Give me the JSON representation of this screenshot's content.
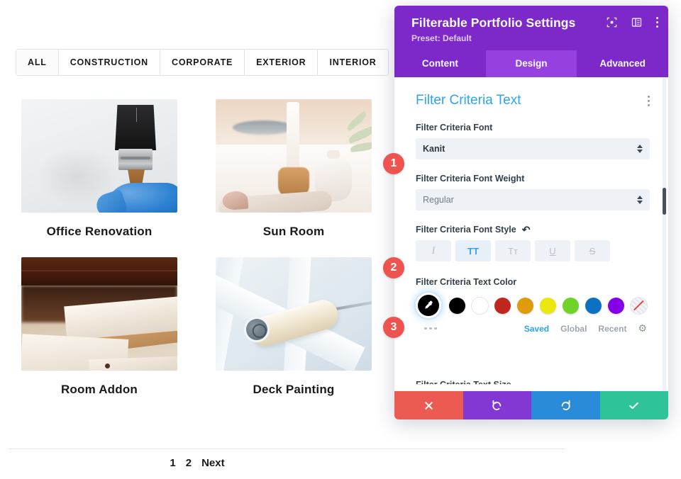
{
  "portfolio": {
    "filters": [
      {
        "label": "ALL",
        "active": true
      },
      {
        "label": "CONSTRUCTION",
        "active": false
      },
      {
        "label": "CORPORATE",
        "active": false
      },
      {
        "label": "EXTERIOR",
        "active": false
      },
      {
        "label": "INTERIOR",
        "active": false
      }
    ],
    "items": [
      {
        "title": "Office Renovation",
        "image": "paint-brush-blue-glove-white-wall"
      },
      {
        "title": "Sun Room",
        "image": "candle-vase-sage-still-life"
      },
      {
        "title": "Room Addon",
        "image": "dark-wood-beam-light-planks"
      },
      {
        "title": "Deck Painting",
        "image": "paint-roller-white-fence"
      }
    ],
    "pagination": [
      "1",
      "2",
      "Next"
    ]
  },
  "modal": {
    "title": "Filterable Portfolio Settings",
    "preset": "Preset: Default",
    "header_icons": [
      "focus-target-icon",
      "panel-layout-icon",
      "kebab-menu-icon"
    ],
    "tabs": [
      {
        "label": "Content",
        "active": false
      },
      {
        "label": "Design",
        "active": true
      },
      {
        "label": "Advanced",
        "active": false
      }
    ],
    "section": {
      "title": "Filter Criteria Text",
      "options_icon": "kebab-menu-icon"
    },
    "fields": {
      "font": {
        "label": "Filter Criteria Font",
        "value": "Kanit",
        "control": "select"
      },
      "font_weight": {
        "label": "Filter Criteria Font Weight",
        "value": "Regular",
        "control": "select"
      },
      "font_style": {
        "label": "Filter Criteria Font Style",
        "reset_icon": "undo-reset-icon",
        "buttons": [
          {
            "name": "italic",
            "glyph": "I",
            "active": false
          },
          {
            "name": "uppercase",
            "glyph": "TT",
            "active": true
          },
          {
            "name": "smallcaps",
            "glyph": "Tᴛ",
            "active": false
          },
          {
            "name": "underline",
            "glyph": "U",
            "active": false
          },
          {
            "name": "strikethrough",
            "glyph": "S",
            "active": false
          }
        ]
      },
      "text_color": {
        "label": "Filter Criteria Text Color",
        "picker_icon": "eyedropper-icon",
        "swatches": [
          {
            "name": "black",
            "hex": "#000000"
          },
          {
            "name": "white",
            "hex": "#FFFFFF"
          },
          {
            "name": "red",
            "hex": "#C0261E"
          },
          {
            "name": "orange",
            "hex": "#E09B0B"
          },
          {
            "name": "yellow",
            "hex": "#EDE80C"
          },
          {
            "name": "green",
            "hex": "#6ED42A"
          },
          {
            "name": "blue",
            "hex": "#0C71C3"
          },
          {
            "name": "purple",
            "hex": "#8300E9"
          },
          {
            "name": "none",
            "hex": "transparent"
          }
        ],
        "more_icon": "more-dots-icon",
        "palette_tabs": [
          {
            "label": "Saved",
            "active": true
          },
          {
            "label": "Global",
            "active": false
          },
          {
            "label": "Recent",
            "active": false
          }
        ],
        "settings_icon": "gear-icon"
      },
      "clipped_next_label": "Filter Criteria Text Size"
    },
    "actions": [
      {
        "name": "cancel-button",
        "icon": "close-x-icon",
        "color": "#EB5B52"
      },
      {
        "name": "undo-button",
        "icon": "undo-icon",
        "color": "#8338D4"
      },
      {
        "name": "redo-button",
        "icon": "redo-icon",
        "color": "#2A8BD8"
      },
      {
        "name": "save-button",
        "icon": "checkmark-icon",
        "color": "#2FC39A"
      }
    ],
    "scrollbar": {
      "visible": true
    }
  },
  "callouts": [
    {
      "number": "1",
      "target": "font-select"
    },
    {
      "number": "2",
      "target": "font-style-buttons"
    },
    {
      "number": "3",
      "target": "text-color-picker"
    }
  ]
}
